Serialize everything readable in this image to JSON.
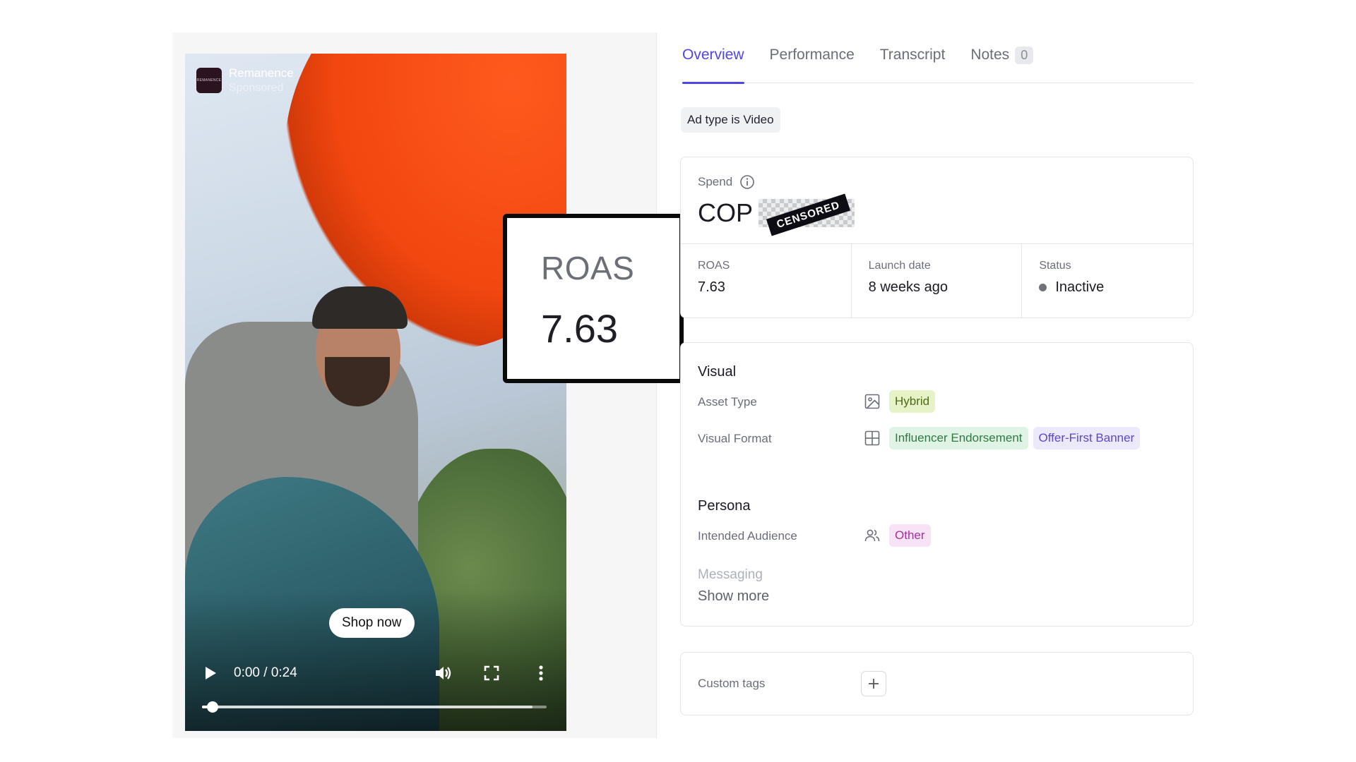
{
  "video": {
    "brand_name": "Remanence",
    "sponsored_label": "Sponsored",
    "avatar_text": "REMANENCE",
    "cta_label": "Shop now",
    "time_display": "0:00 / 0:24",
    "progress_fraction": 0.03,
    "buffered_fraction": 0.96
  },
  "highlight": {
    "label": "ROAS",
    "value": "7.63"
  },
  "tabs": [
    {
      "label": "Overview",
      "active": true
    },
    {
      "label": "Performance"
    },
    {
      "label": "Transcript"
    },
    {
      "label": "Notes",
      "count": "0"
    }
  ],
  "ad_type_chip": "Ad type is Video",
  "spend": {
    "label": "Spend",
    "currency": "COP",
    "censored_label": "CENSORED"
  },
  "metrics": {
    "roas": {
      "label": "ROAS",
      "value": "7.63"
    },
    "launch": {
      "label": "Launch date",
      "value": "8 weeks ago"
    },
    "status": {
      "label": "Status",
      "value": "Inactive",
      "color": "#707379"
    }
  },
  "visual": {
    "title": "Visual",
    "asset_type": {
      "label": "Asset Type",
      "tags": [
        "Hybrid"
      ]
    },
    "visual_format": {
      "label": "Visual Format",
      "tags": [
        "Influencer Endorsement",
        "Offer-First Banner"
      ]
    }
  },
  "persona": {
    "title": "Persona",
    "audience": {
      "label": "Intended Audience",
      "tags": [
        "Other"
      ]
    },
    "messaging_label": "Messaging",
    "show_more": "Show more"
  },
  "custom_tags": {
    "label": "Custom tags"
  },
  "colors": {
    "accent": "#5046e5"
  }
}
